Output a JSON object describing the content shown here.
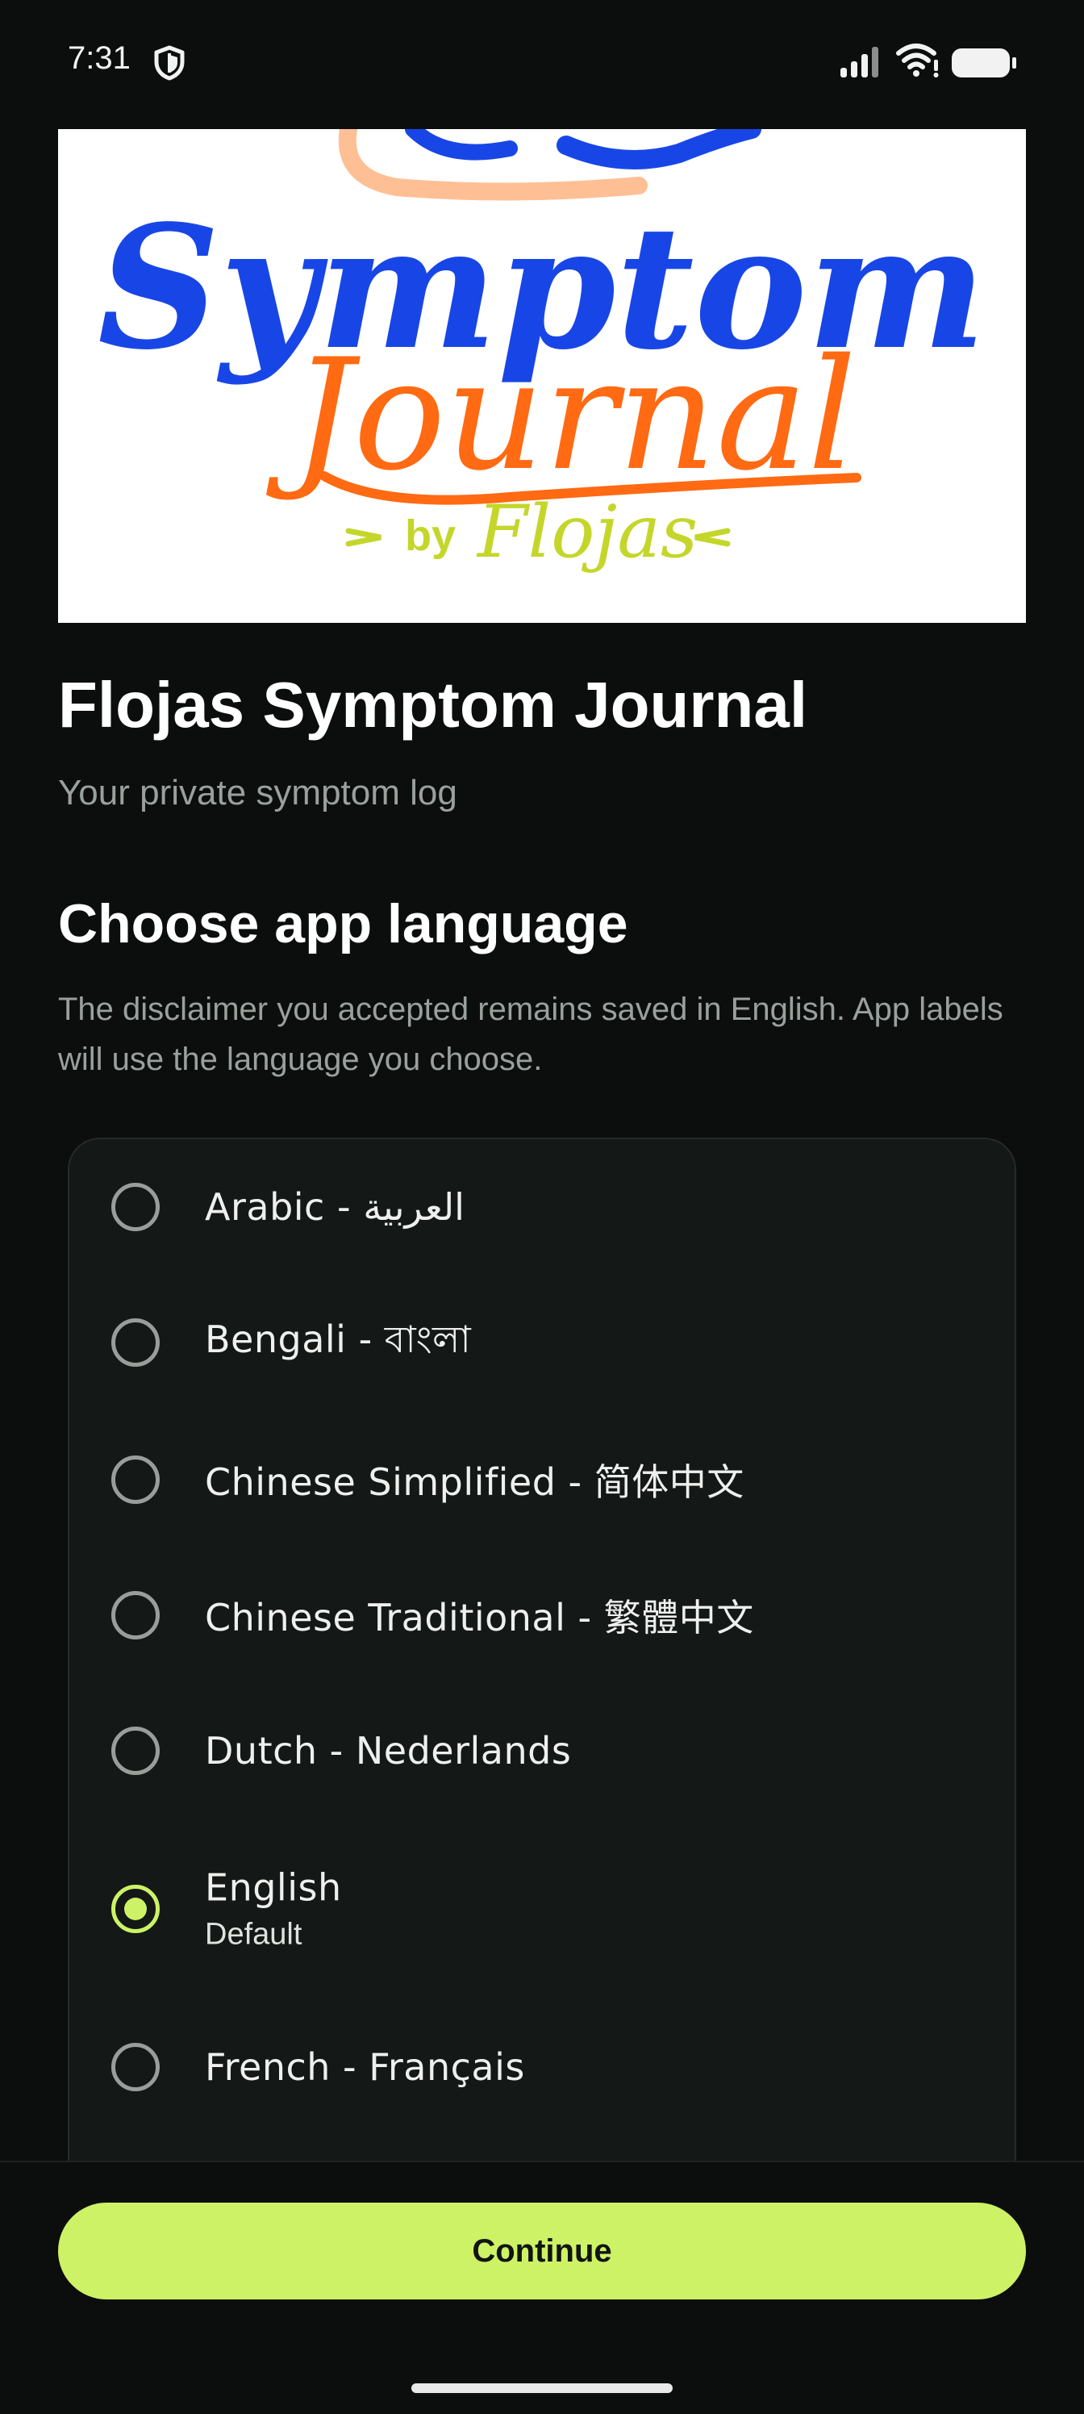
{
  "status_bar": {
    "time": "7:31",
    "icons": [
      "shield-icon",
      "signal-icon",
      "wifi-icon",
      "battery-icon"
    ]
  },
  "banner": {
    "logo_words": [
      "Symptom",
      "Journal",
      "by",
      "Flojas"
    ],
    "colors": {
      "symptom": "#1846e6",
      "journal": "#ff6a13",
      "byline": "#c4d62a",
      "swirl": "#ffbf94"
    }
  },
  "header": {
    "title": "Flojas Symptom Journal",
    "subtitle": "Your private symptom log"
  },
  "language_section": {
    "title": "Choose app language",
    "description": "The disclaimer you accepted remains saved in English. App labels will use the language you choose.",
    "selected": "English",
    "options": [
      {
        "label": "Arabic - العربية",
        "sub": "",
        "selected": false
      },
      {
        "label": "Bengali - বাংলা",
        "sub": "",
        "selected": false
      },
      {
        "label": "Chinese Simplified - 简体中文",
        "sub": "",
        "selected": false
      },
      {
        "label": "Chinese Traditional - 繁體中文",
        "sub": "",
        "selected": false
      },
      {
        "label": "Dutch - Nederlands",
        "sub": "",
        "selected": false
      },
      {
        "label": "English",
        "sub": "Default",
        "selected": true
      },
      {
        "label": "French - Français",
        "sub": "",
        "selected": false
      }
    ]
  },
  "footer": {
    "continue_label": "Continue"
  },
  "theme": {
    "accent": "#cdf266",
    "background": "#0b0e0d",
    "card": "#141816",
    "muted_text": "#9aa09c"
  }
}
